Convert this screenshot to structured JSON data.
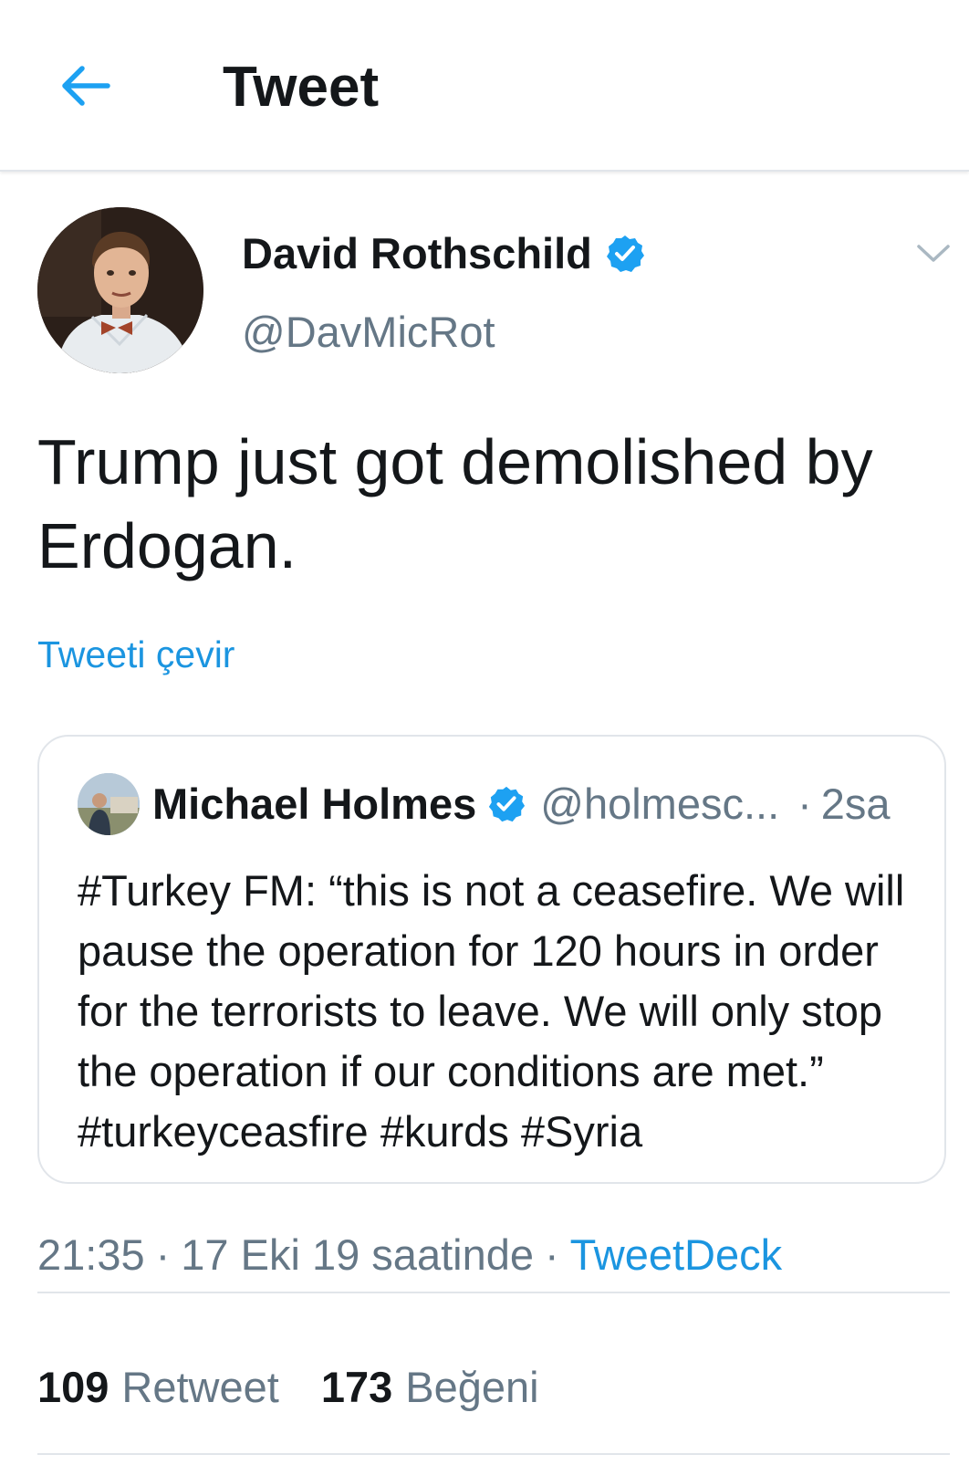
{
  "header": {
    "title": "Tweet",
    "back_icon": "arrow-left-icon",
    "accent": "#1da1f2"
  },
  "tweet": {
    "author_name": "David Rothschild",
    "author_handle": "@DavMicRot",
    "verified": true,
    "text": "Trump just got demolished by Erdogan.",
    "translate_label": "Tweeti çevir",
    "more_icon": "chevron-down-icon"
  },
  "quoted_tweet": {
    "author_name": "Michael Holmes",
    "author_handle": "@holmesc...",
    "separator": "·",
    "time": "2sa",
    "verified": true,
    "text": "#Turkey FM:  “this is not a ceasefire.   We will pause the operation for 120 hours in order for the terrorists to leave.  We will only stop the operation if our conditions are met.” #turkeyceasfire #kurds #Syria"
  },
  "meta": {
    "time": "21:35",
    "separator": "·",
    "date": "17 Eki 19 saatinde",
    "source": "TweetDeck"
  },
  "stats": {
    "retweets": {
      "count": "109",
      "label": "Retweet"
    },
    "likes": {
      "count": "173",
      "label": "Beğeni"
    }
  },
  "colors": {
    "link": "#1b95e0",
    "verified_badge": "#1da1f2",
    "secondary_text": "#657786",
    "divider": "#e1e5ea"
  }
}
